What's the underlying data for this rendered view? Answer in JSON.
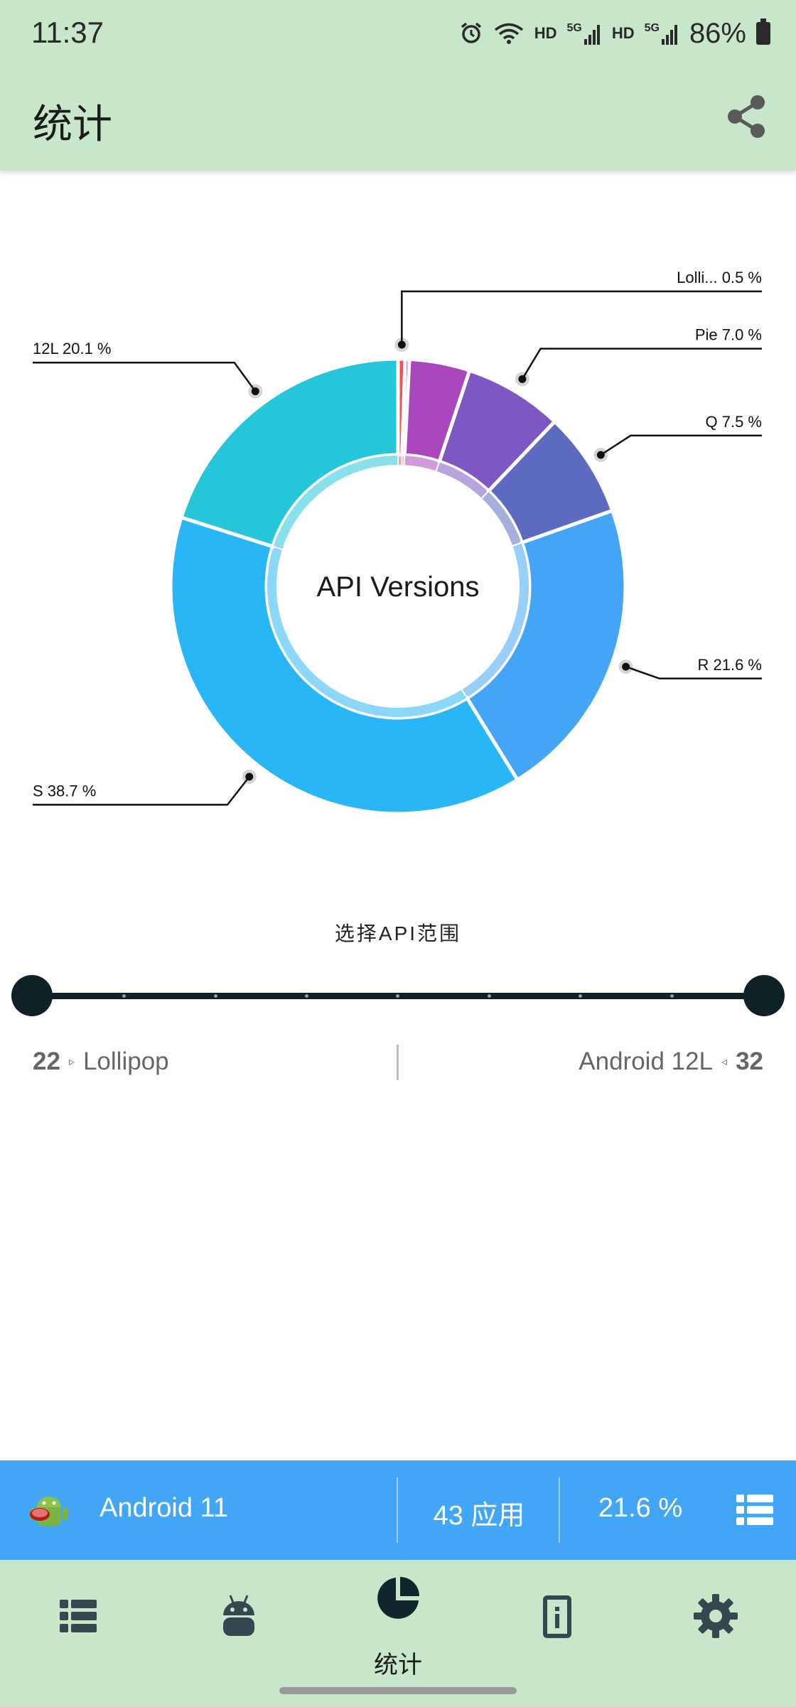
{
  "status_bar": {
    "time": "11:37",
    "hd_1": "HD",
    "net_1": "5G",
    "hd_2": "HD",
    "net_2": "5G",
    "battery": "86%"
  },
  "app_bar": {
    "title": "统计"
  },
  "chart_data": {
    "type": "pie",
    "donut": true,
    "center_label": "API Versions",
    "slices": [
      {
        "label": "Lolli... 0.5 %",
        "value": 0.5,
        "color": "#ef5350"
      },
      {
        "label": "",
        "value": 0.3,
        "color": "#ec407a"
      },
      {
        "label": "",
        "value": 4.3,
        "color": "#ab47bc"
      },
      {
        "label": "Pie 7.0 %",
        "value": 7.0,
        "color": "#7e57c2"
      },
      {
        "label": "Q 7.5 %",
        "value": 7.5,
        "color": "#5c6bc0"
      },
      {
        "label": "R 21.6 %",
        "value": 21.6,
        "color": "#42a5f5"
      },
      {
        "label": "S 38.7 %",
        "value": 38.7,
        "color": "#29b6f6"
      },
      {
        "label": "12L 20.1 %",
        "value": 20.1,
        "color": "#26c6da"
      }
    ]
  },
  "range": {
    "title": "选择API范围",
    "min_api": "22",
    "min_name": "Lollipop",
    "max_api": "32",
    "max_name": "Android 12L",
    "arrow_right": "▹",
    "arrow_left": "◃"
  },
  "info_bar": {
    "version": "Android 11",
    "apps": "43 应用",
    "percent": "21.6 %"
  },
  "bottom_nav": {
    "stats_label": "统计"
  },
  "colors": {
    "bar_green": "#c8e6c9",
    "accent_blue": "#42a5f5",
    "slider": "#0f2027"
  }
}
